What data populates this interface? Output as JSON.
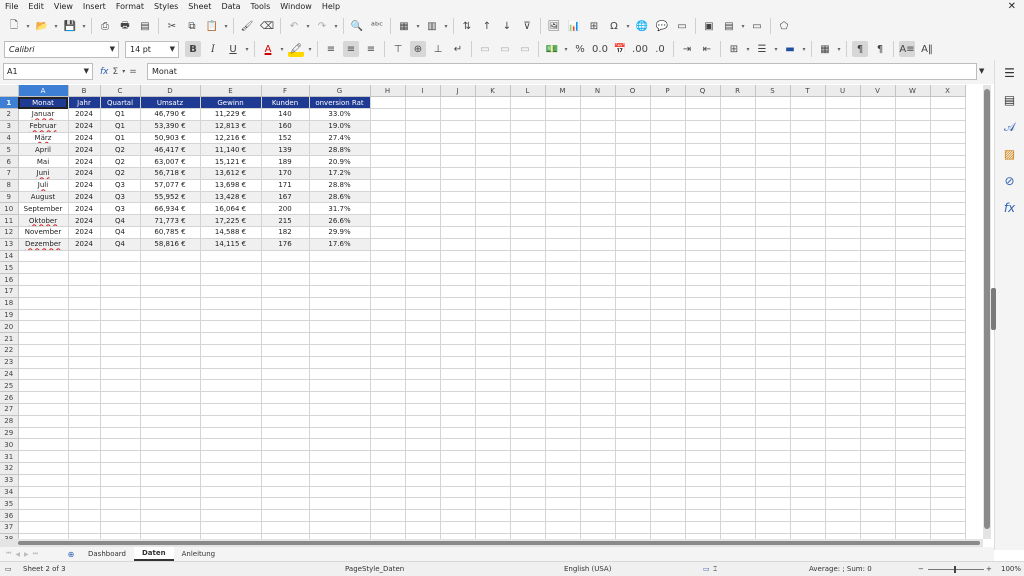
{
  "menu": [
    "File",
    "Edit",
    "View",
    "Insert",
    "Format",
    "Styles",
    "Sheet",
    "Data",
    "Tools",
    "Window",
    "Help"
  ],
  "window_close": "✕",
  "format": {
    "font_name": "Calibri",
    "font_size": "14 pt"
  },
  "formula_bar": {
    "cell_ref": "A1",
    "content": "Monat",
    "fx": "fx",
    "sum": "Σ",
    "equals": "="
  },
  "columns": [
    "A",
    "B",
    "C",
    "D",
    "E",
    "F",
    "G",
    "H",
    "I",
    "J",
    "K",
    "L",
    "M",
    "N",
    "O",
    "P",
    "Q",
    "R",
    "S",
    "T",
    "U",
    "V",
    "W",
    "X"
  ],
  "table": {
    "headers": [
      "Monat",
      "Jahr",
      "Quartal",
      "Umsatz",
      "Gewinn",
      "Kunden",
      "onversion Rat"
    ],
    "rows": [
      [
        "Januar",
        "2024",
        "Q1",
        "46,790 €",
        "11,229 €",
        "140",
        "33.0%"
      ],
      [
        "Februar",
        "2024",
        "Q1",
        "53,390 €",
        "12,813 €",
        "160",
        "19.0%"
      ],
      [
        "März",
        "2024",
        "Q1",
        "50,903 €",
        "12,216 €",
        "152",
        "27.4%"
      ],
      [
        "April",
        "2024",
        "Q2",
        "46,417 €",
        "11,140 €",
        "139",
        "28.8%"
      ],
      [
        "Mai",
        "2024",
        "Q2",
        "63,007 €",
        "15,121 €",
        "189",
        "20.9%"
      ],
      [
        "Juni",
        "2024",
        "Q2",
        "56,718 €",
        "13,612 €",
        "170",
        "17.2%"
      ],
      [
        "Juli",
        "2024",
        "Q3",
        "57,077 €",
        "13,698 €",
        "171",
        "28.8%"
      ],
      [
        "August",
        "2024",
        "Q3",
        "55,952 €",
        "13,428 €",
        "167",
        "28.6%"
      ],
      [
        "September",
        "2024",
        "Q3",
        "66,934 €",
        "16,064 €",
        "200",
        "31.7%"
      ],
      [
        "Oktober",
        "2024",
        "Q4",
        "71,773 €",
        "17,225 €",
        "215",
        "26.6%"
      ],
      [
        "November",
        "2024",
        "Q4",
        "60,785 €",
        "14,588 €",
        "182",
        "29.9%"
      ],
      [
        "Dezember",
        "2024",
        "Q4",
        "58,816 €",
        "14,115 €",
        "176",
        "17.6%"
      ]
    ],
    "header_color": "#1f3a93",
    "stripe_color": "#f0f0f0"
  },
  "visible_row_count": 38,
  "selection_color": "#3e7fd6",
  "sheet_tabs": [
    "Dashboard",
    "Daten",
    "Anleitung"
  ],
  "active_sheet": "Daten",
  "status": {
    "sheet": "Sheet 2 of 3",
    "page_style": "PageStyle_Daten",
    "language": "English (USA)",
    "summary": "Average: ; Sum: 0",
    "zoom": "100%",
    "zoom_minus": "−",
    "zoom_plus": "+"
  },
  "icons": {
    "toolbar1": [
      "new-icon",
      "open-icon",
      "save-icon",
      "export-pdf-icon",
      "print-icon",
      "print-preview-icon",
      "cut-icon",
      "copy-icon",
      "paste-icon",
      "clone-formatting-icon",
      "clear-formatting-icon",
      "undo-icon",
      "redo-icon",
      "find-replace-icon",
      "spelling-icon",
      "row-icon",
      "column-icon",
      "insert-chart-icon",
      "sort-icon",
      "sort-ascending-icon",
      "sort-descending-icon",
      "autofilter-icon",
      "insert-image-icon",
      "insert-chart-icon",
      "pivot-table-icon",
      "special-character-icon",
      "hyperlink-icon",
      "comment-icon",
      "headers-footers-icon",
      "define-print-area-icon",
      "freeze-rows-columns-icon",
      "split-window-icon",
      "show-draw-functions-icon"
    ],
    "sidebar": [
      "sidebar-menu-icon",
      "properties-icon",
      "styles-icon",
      "gallery-icon",
      "navigator-icon",
      "functions-icon"
    ]
  }
}
